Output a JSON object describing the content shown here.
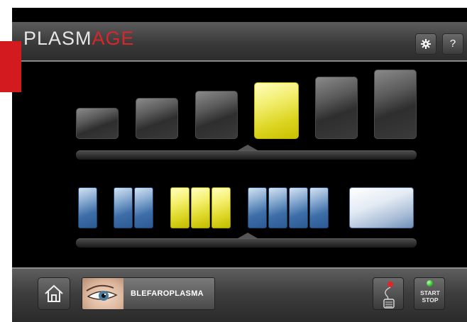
{
  "app": {
    "logo_part1": "PLASM",
    "logo_part2": "AGE"
  },
  "header": {
    "settings_icon": "gear-icon",
    "help_label": "?"
  },
  "intensity": {
    "levels": 6,
    "selected_level": 4,
    "selected_color": "#e8e23a"
  },
  "tip": {
    "groups": [
      1,
      2,
      3,
      4,
      1
    ],
    "selected_group": 3,
    "colors": {
      "blue": "#3d6ea8",
      "yellow": "#e8e23a"
    }
  },
  "footer": {
    "home_icon": "home-icon",
    "program_label": "BLEFAROPLASMA",
    "footswitch_icon": "footswitch-icon",
    "start_label": "START",
    "stop_label": "STOP",
    "start_led_color": "#2fbf2a"
  }
}
